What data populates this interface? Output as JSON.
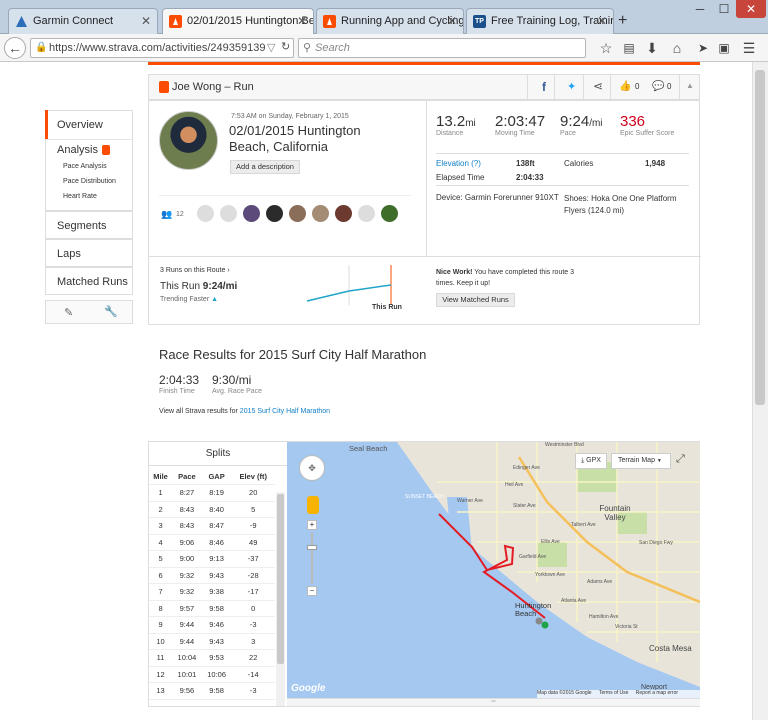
{
  "browser": {
    "tabs": [
      {
        "title": "Garmin Connect",
        "active": false,
        "icon": "garmin-triangle-icon",
        "color": "#2a6ebb"
      },
      {
        "title": "02/01/2015 Huntington Be...",
        "active": true,
        "icon": "strava-icon",
        "color": "#fc4c02"
      },
      {
        "title": "Running App and Cycling ...",
        "active": false,
        "icon": "strava-icon",
        "color": "#fc4c02"
      },
      {
        "title": "Free Training Log, Training...",
        "active": false,
        "icon": "trainingpeaks-icon",
        "color": "#1a4f8b"
      }
    ],
    "new_tab": "+",
    "url": "https://www.strava.com/activities/249359139",
    "search_placeholder": "Search"
  },
  "header": {
    "title": "Joe Wong – Run",
    "likes": "0",
    "comments": "0"
  },
  "sidebar": {
    "overview": "Overview",
    "analysis": "Analysis",
    "sub": [
      "Pace Analysis",
      "Pace Distribution",
      "Heart Rate"
    ],
    "segments": "Segments",
    "laps": "Laps",
    "matched": "Matched Runs"
  },
  "activity": {
    "datetime": "7:53 AM on Sunday, February 1, 2015",
    "title_line1": "02/01/2015 Huntington",
    "title_line2": "Beach, California",
    "add_description": "Add a description",
    "kudos": "12",
    "distance": "13.2",
    "distance_unit": "mi",
    "distance_label": "Distance",
    "moving_time": "2:03:47",
    "moving_time_label": "Moving Time",
    "pace": "9:24",
    "pace_unit": "/mi",
    "pace_label": "Pace",
    "suffer": "336",
    "suffer_label": "Epic Suffer Score",
    "elevation_label": "Elevation (?)",
    "elevation": "138ft",
    "calories_label": "Calories",
    "calories": "1,948",
    "elapsed_label": "Elapsed Time",
    "elapsed": "2:04:33",
    "device": "Device: Garmin Forerunner 910XT",
    "shoes": "Shoes: Hoka One One Platform Flyers (124.0 mi)"
  },
  "matched": {
    "runs_on_route": "3 Runs on this Route",
    "this_run_label": "This Run",
    "this_run_pace": "9:24/mi",
    "trend": "Trending Faster",
    "chart_label": "This Run",
    "nice_work": "Nice Work!",
    "message": " You have completed this route 3 times. Keep it up!",
    "view_button": "View Matched Runs"
  },
  "race": {
    "title": "Race Results for 2015 Surf City Half Marathon",
    "finish_time": "2:04:33",
    "finish_label": "Finish Time",
    "race_pace": "9:30/mi",
    "race_pace_label": "Avg. Race Pace",
    "view_all_prefix": "View all Strava results for ",
    "view_all_link": "2015 Surf City Half Marathon"
  },
  "splits": {
    "title": "Splits",
    "headers": [
      "Mile",
      "Pace",
      "GAP",
      "Elev (ft)"
    ],
    "rows": [
      [
        "1",
        "8:27",
        "8:19",
        "20"
      ],
      [
        "2",
        "8:43",
        "8:40",
        "5"
      ],
      [
        "3",
        "8:43",
        "8:47",
        "-9"
      ],
      [
        "4",
        "9:06",
        "8:46",
        "49"
      ],
      [
        "5",
        "9:00",
        "9:13",
        "-37"
      ],
      [
        "6",
        "9:32",
        "9:43",
        "-28"
      ],
      [
        "7",
        "9:32",
        "9:38",
        "-17"
      ],
      [
        "8",
        "9:57",
        "9:58",
        "0"
      ],
      [
        "9",
        "9:44",
        "9:46",
        "-3"
      ],
      [
        "10",
        "9:44",
        "9:43",
        "3"
      ],
      [
        "11",
        "10:04",
        "9:53",
        "22"
      ],
      [
        "12",
        "10:01",
        "10:06",
        "-14"
      ],
      [
        "13",
        "9:56",
        "9:58",
        "-3"
      ]
    ]
  },
  "map": {
    "gpx": "GPX",
    "terrain": "Terrain Map",
    "labels": {
      "seal_beach": "Seal Beach",
      "sunset_beach": "SUNSET BEACH",
      "fountain_valley": "Fountain Valley",
      "huntington_beach": "Huntington Beach",
      "costa_mesa": "Costa Mesa",
      "newport": "Newport",
      "westminster": "Westminster Blvd",
      "edinger": "Edinger Ave",
      "heil": "Heil Ave",
      "warner": "Warner Ave",
      "slater": "Slater Ave",
      "talbert": "Talbert Ave",
      "ellis": "Ellis Ave",
      "garfield": "Garfield Ave",
      "yorktown": "Yorktown Ave",
      "adams": "Adams Ave",
      "atlanta": "Atlanta Ave",
      "hamilton": "Hamilton Ave",
      "victoria": "Victoria St",
      "sandiego": "San Diego Fwy"
    },
    "google": "Google",
    "mapdata": "Map data ©2015 Google",
    "terms": "Terms of Use",
    "report": "Report a map error"
  },
  "colors": {
    "accent": "#fc4c02",
    "link": "#0f7fc5",
    "route": "#e31b23",
    "water": "#a4c8f0",
    "land": "#e8e4da",
    "park": "#c8dfa8"
  }
}
